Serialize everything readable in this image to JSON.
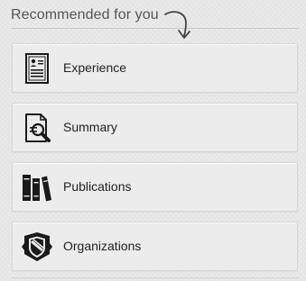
{
  "header": {
    "title": "Recommended for you"
  },
  "items": [
    {
      "label": "Experience",
      "icon": "resume-document-icon"
    },
    {
      "label": "Summary",
      "icon": "document-search-icon"
    },
    {
      "label": "Publications",
      "icon": "books-icon"
    },
    {
      "label": "Organizations",
      "icon": "shield-badge-icon"
    }
  ],
  "colors": {
    "background": "#ebebeb",
    "card": "#ececec",
    "card_border": "#d5d5d5",
    "text": "#222222",
    "header_text": "#555555"
  }
}
